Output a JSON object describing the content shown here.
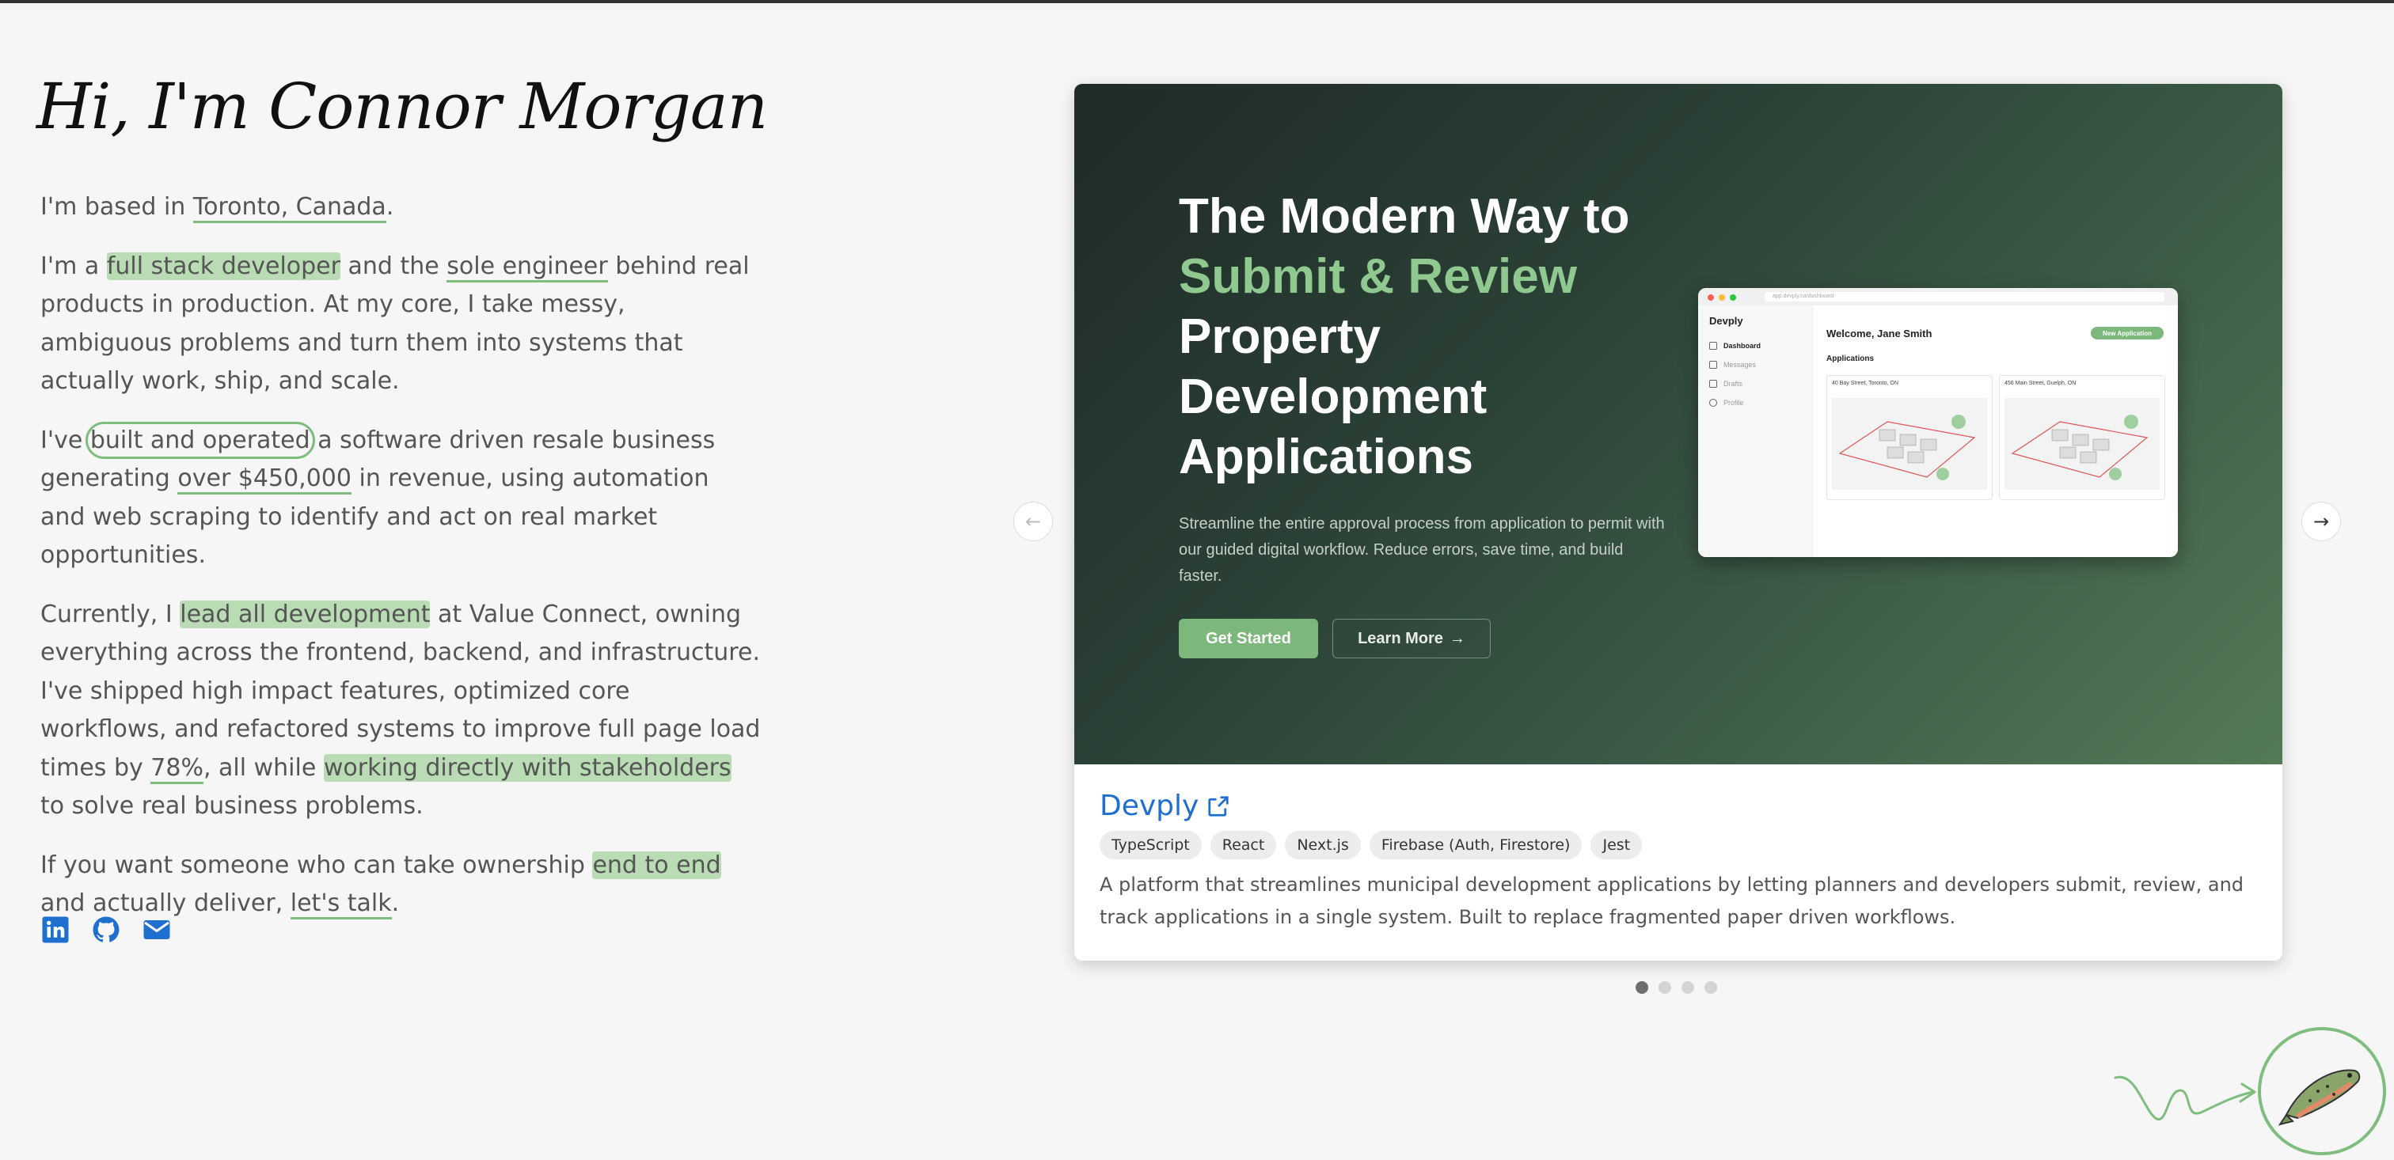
{
  "intro": {
    "title": "Hi, I'm Connor Morgan",
    "p1": {
      "a": "I'm based in ",
      "loc": "Toronto, Canada",
      "b": "."
    },
    "p2": {
      "a": "I'm a ",
      "hl1": "full stack developer",
      "b": " and the ",
      "ul1": "sole engineer",
      "c": " behind real products in production. At my core, I take messy, ambiguous problems and turn them into systems that actually work, ship, and scale."
    },
    "p3": {
      "a": "I've ",
      "circ": "built and operated",
      "b": " a software driven resale business generating ",
      "ul": "over $450,000",
      "c": " in revenue, using automation and web scraping to identify and act on real market opportunities."
    },
    "p4": {
      "a": "Currently, I ",
      "hl1": "lead all development",
      "b": " at Value Connect, owning everything across the frontend, backend, and infrastructure. I've shipped high impact features, optimized core workflows, and refactored systems to improve full page load times by ",
      "ul": "78%",
      "c": ", all while ",
      "hl2": "working directly with stakeholders",
      "d": " to solve real business problems."
    },
    "p5": {
      "a": "If you want someone who can take ownership ",
      "hl": "end to end",
      "b": " and actually deliver, ",
      "ul": "let's talk",
      "c": "."
    }
  },
  "socials": [
    {
      "icon": "linkedin-icon"
    },
    {
      "icon": "github-icon"
    },
    {
      "icon": "mail-icon"
    }
  ],
  "carousel": {
    "prev_icon": "arrow-left-icon",
    "next_icon": "arrow-right-icon",
    "active_index": 0,
    "total_slides": 4,
    "hero": {
      "line1": "The Modern Way to",
      "accent": "Submit & Review",
      "line3": "Property Development Applications",
      "subtitle": "Streamline the entire approval process from application to permit with our guided digital workflow. Reduce errors, save time, and build faster.",
      "primary_label": "Get Started",
      "secondary_label": "Learn More",
      "secondary_arrow": "→"
    },
    "mock": {
      "url": "app.devply.ca/dashboard",
      "brand": "Devply",
      "nav": [
        "Dashboard",
        "Messages",
        "Drafts",
        "Profile"
      ],
      "welcome": "Welcome, Jane Smith",
      "new_app": "New Application",
      "apps_title": "Applications",
      "tiles": [
        "40 Bay Street, Toronto, ON",
        "456 Main Street, Guelph, ON"
      ]
    },
    "project": {
      "name": "Devply",
      "tags": [
        "TypeScript",
        "React",
        "Next.js",
        "Firebase (Auth, Firestore)",
        "Jest"
      ],
      "description": "A platform that streamlines municipal development applications by letting planners and developers submit, review, and track applications in a single system. Built to replace fragmented paper driven workflows."
    }
  },
  "colors": {
    "accent_green": "#7cb77c",
    "link_blue": "#1f6fd1",
    "highlight": "#b9dcb4"
  }
}
